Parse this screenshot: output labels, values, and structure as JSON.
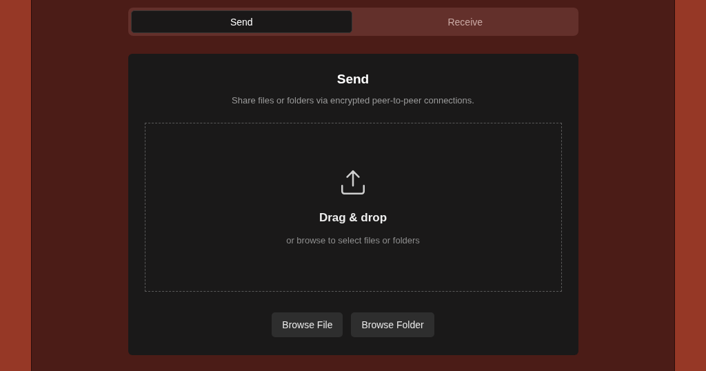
{
  "tabs": [
    {
      "label": "Send",
      "selected": true
    },
    {
      "label": "Receive",
      "selected": false
    }
  ],
  "panel": {
    "title": "Send",
    "subtitle": "Share files or folders via encrypted peer-to-peer connections.",
    "dropzone": {
      "title": "Drag & drop",
      "hint": "or browse to select files or folders"
    },
    "buttons": [
      "Browse File",
      "Browse Folder"
    ]
  }
}
